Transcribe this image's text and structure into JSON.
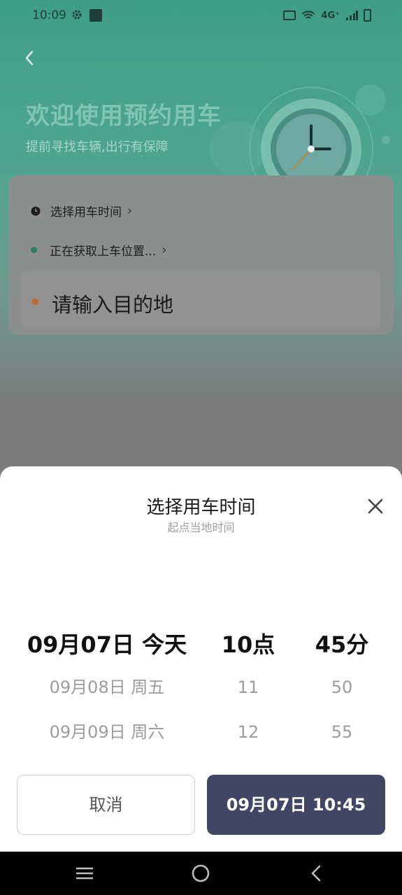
{
  "status_bar": {
    "time": "10:09",
    "network": "4G⁺",
    "icons": [
      "gear-icon",
      "mail-icon",
      "vibrate-icon",
      "wifi-icon",
      "signal-icon",
      "battery-icon"
    ]
  },
  "header": {
    "title": "欢迎使用预约用车",
    "subtitle": "提前寻找车辆,出行有保障",
    "back_icon": "chevron-left-icon"
  },
  "trip": {
    "time_label": "选择用车时间",
    "pickup_label": "正在获取上车位置...",
    "destination_placeholder": "请输入目的地",
    "chevron": "›"
  },
  "time_picker": {
    "title": "选择用车时间",
    "subtitle": "起点当地时间",
    "dates": [
      "09月07日 今天",
      "09月08日 周五",
      "09月09日 周六"
    ],
    "hours": [
      "10点",
      "11",
      "12"
    ],
    "minutes": [
      "45分",
      "50",
      "55"
    ],
    "cancel_label": "取消",
    "confirm_label": "09月07日 10:45"
  },
  "colors": {
    "header_green": "#3f9e85",
    "confirm_button": "#3f4764",
    "destination_dot": "#c4652b",
    "pickup_dot": "#2e7d5f"
  }
}
